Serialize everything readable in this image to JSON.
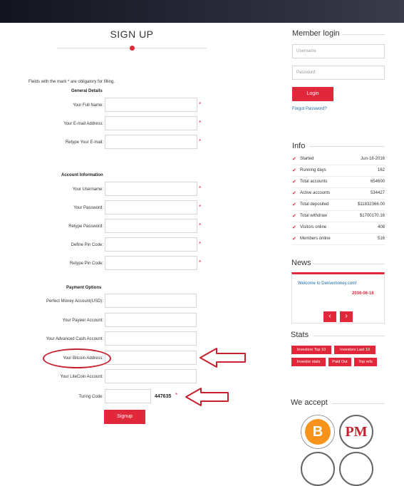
{
  "signup": {
    "title": "SIGN UP",
    "note": "Fields with the mark * are obligatory for filling.",
    "sections": {
      "general": "General Details",
      "account": "Account Information",
      "payment": "Payment Options"
    },
    "labels": {
      "full_name": "Your Full Name:",
      "email": "Your E-mail Address:",
      "retype_email": "Retype Your E-mail:",
      "username": "Your Username:",
      "password": "Your Password:",
      "retype_password": "Retype Password:",
      "pin": "Define Pin Code:",
      "retype_pin": "Retype Pin Code:",
      "perfect_money": "Perfect Money Account(USD):",
      "payeer": "Your Payeer Account:",
      "advcash": "Your Advanced Cash Account:",
      "bitcoin": "Your Bitcoin Address:",
      "litecoin": "Your LiteCoin Account:",
      "turing": "Turing Code:"
    },
    "required_mark": "*",
    "turing_value": "447635",
    "submit": "Signup"
  },
  "sidebar": {
    "login": {
      "title": "Member login",
      "username_placeholder": "Username",
      "password_placeholder": "Password",
      "button": "Login",
      "forgot": "Forgot Password?"
    },
    "info": {
      "title": "Info",
      "rows": [
        {
          "label": "Started",
          "value": "Jun-18-2016"
        },
        {
          "label": "Running days",
          "value": "162"
        },
        {
          "label": "Total accounts",
          "value": "654600"
        },
        {
          "label": "Active accounts",
          "value": "534427"
        },
        {
          "label": "Total deposited",
          "value": "$11832366.00"
        },
        {
          "label": "Total withdraw",
          "value": "$1700170.16"
        },
        {
          "label": "Visitors online",
          "value": "408"
        },
        {
          "label": "Members online",
          "value": "516"
        }
      ]
    },
    "news": {
      "title": "News",
      "item": "Welcome to Derivemoney.com!",
      "date": "2016-06-18",
      "prev": "‹",
      "next": "›"
    },
    "stats": {
      "title": "Stats",
      "tags": [
        "Investors Top 10",
        "Investors Last 10",
        "Investor stats",
        "Paid Out",
        "Top refs"
      ]
    },
    "accept": {
      "title": "We accept",
      "bitcoin_symbol": "B",
      "pm_text": "PM"
    }
  },
  "colors": {
    "accent": "#e0283a",
    "annotation": "#c8202e"
  }
}
